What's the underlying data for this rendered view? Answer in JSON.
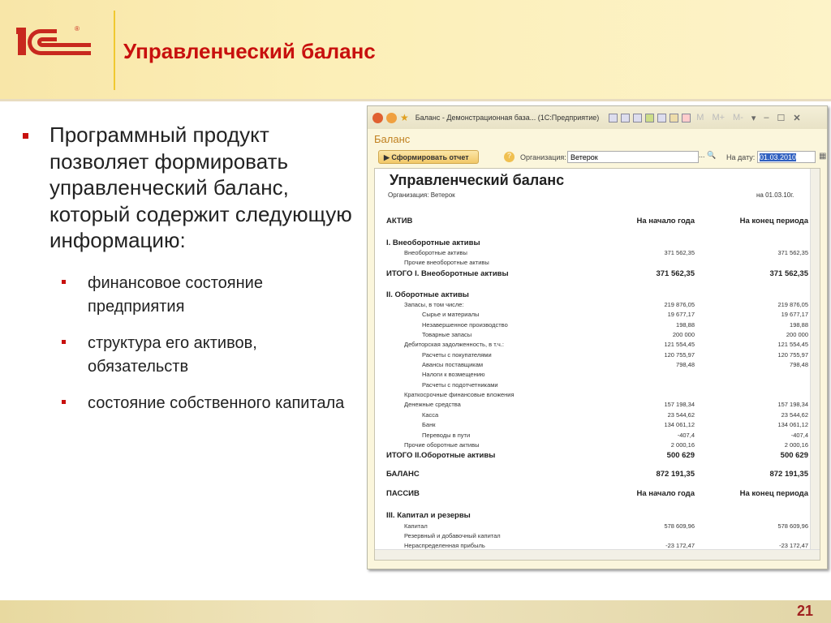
{
  "slide": {
    "title": "Управленческий баланс",
    "page_number": "21",
    "logo_text": "1С",
    "bullet": "Программный продукт позволяет формировать управленческий баланс, который содержит следующую информацию:",
    "subbullets": [
      "финансовое состояние предприятия",
      "структура его активов, обязательств",
      "состояние собственного капитала"
    ]
  },
  "window": {
    "title": "Баланс - Демонстрационная база... (1С:Предприятие)",
    "tb_m": "M",
    "tb_mplus": "M+",
    "tb_mminus": "M-",
    "form_title": "Баланс",
    "run_button": "▶ Сформировать отчет",
    "help": "?",
    "org_label": "Организация:",
    "org_value": "Ветерок",
    "org_buttons": "... 🔍",
    "date_label": "На дату:",
    "date_value": "01.03.2010"
  },
  "report": {
    "title": "Управленческий баланс",
    "org": "Организация: Ветерок",
    "date": "на 01.03.10г.",
    "rows": [
      {
        "k": "header",
        "l": "АКТИВ",
        "a": "На начало года",
        "b": "На конец периода"
      },
      {
        "k": "section",
        "l": "I. Внеоборотные активы",
        "a": "",
        "b": ""
      },
      {
        "k": "item",
        "l": "Внеоборотные активы",
        "a": "371 562,35",
        "b": "371 562,35"
      },
      {
        "k": "item",
        "l": "Прочие внеоборотные активы",
        "a": "",
        "b": ""
      },
      {
        "k": "total",
        "l": "ИТОГО I. Внеоборотные активы",
        "a": "371 562,35",
        "b": "371 562,35"
      },
      {
        "k": "section",
        "l": "II. Оборотные активы",
        "a": "",
        "b": ""
      },
      {
        "k": "item",
        "l": "Запасы, в том числе:",
        "a": "219 876,05",
        "b": "219 876,05"
      },
      {
        "k": "sub",
        "l": "Сырье и материалы",
        "a": "19 677,17",
        "b": "19 677,17"
      },
      {
        "k": "sub",
        "l": "Незавершенное производство",
        "a": "198,88",
        "b": "198,88"
      },
      {
        "k": "sub",
        "l": "Товарные запасы",
        "a": "200 000",
        "b": "200 000"
      },
      {
        "k": "item",
        "l": "Дебиторская задолженность, в т.ч.:",
        "a": "121 554,45",
        "b": "121 554,45"
      },
      {
        "k": "sub",
        "l": "Расчеты с покупателями",
        "a": "120 755,97",
        "b": "120 755,97"
      },
      {
        "k": "sub",
        "l": "Авансы поставщикам",
        "a": "798,48",
        "b": "798,48"
      },
      {
        "k": "sub",
        "l": "Налоги к возмещению",
        "a": "",
        "b": ""
      },
      {
        "k": "sub",
        "l": "Расчеты с подотчетниками",
        "a": "",
        "b": ""
      },
      {
        "k": "item",
        "l": "Краткосрочные финансовые вложения",
        "a": "",
        "b": ""
      },
      {
        "k": "item",
        "l": "Денежные средства",
        "a": "157 198,34",
        "b": "157 198,34"
      },
      {
        "k": "sub",
        "l": "Касса",
        "a": "23 544,62",
        "b": "23 544,62"
      },
      {
        "k": "sub",
        "l": "Банк",
        "a": "134 061,12",
        "b": "134 061,12"
      },
      {
        "k": "sub",
        "l": "Переводы в пути",
        "a": "-407,4",
        "b": "-407,4"
      },
      {
        "k": "item",
        "l": "Прочие оборотные активы",
        "a": "2 000,16",
        "b": "2 000,16"
      },
      {
        "k": "total",
        "l": "ИТОГО II.Оборотные активы",
        "a": "500 629",
        "b": "500 629"
      },
      {
        "k": "grand",
        "l": "БАЛАНС",
        "a": "872 191,35",
        "b": "872 191,35"
      },
      {
        "k": "grand",
        "l": "ПАССИВ",
        "a": "На начало года",
        "b": "На конец периода"
      },
      {
        "k": "section",
        "l": "III. Капитал и резервы",
        "a": "",
        "b": ""
      },
      {
        "k": "item",
        "l": "Капитал",
        "a": "578 609,96",
        "b": "578 609,96"
      },
      {
        "k": "item",
        "l": "Резервный и добавочный капитал",
        "a": "",
        "b": ""
      },
      {
        "k": "item",
        "l": "Нераспределенная прибыль",
        "a": "-23 172,47",
        "b": "-23 172,47"
      }
    ]
  }
}
